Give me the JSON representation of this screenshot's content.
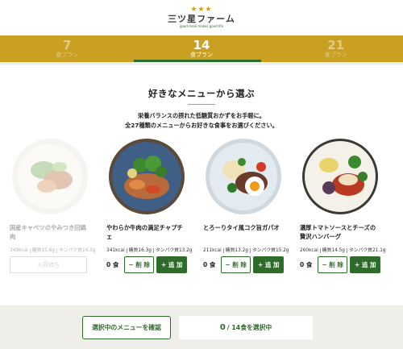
{
  "header": {
    "logo_stars": "★★★",
    "logo_name": "三ツ星ファーム",
    "logo_tagline": "good meal makes good life"
  },
  "plans": [
    {
      "number": "7",
      "label": "食プラン",
      "active": false
    },
    {
      "number": "14",
      "label": "食プラン",
      "active": true
    },
    {
      "number": "21",
      "label": "食プラン",
      "active": false
    }
  ],
  "section": {
    "title": "好きなメニューから選ぶ",
    "desc_line1": "栄養バランスの摂れた低糖質おかずをお手軽に。",
    "desc_line2": "全27種類のメニューからお好きな食事をお選びください。"
  },
  "menu": [
    {
      "name": "国産キャベツのやみつき回鍋肉",
      "kcal": "349kcal",
      "sugar": "糖質15.6g",
      "protein": "タンパク質14.3g",
      "status": "soldout",
      "wait_label": "入荷待ち",
      "plate_color": "#f3efe6"
    },
    {
      "name": "やわらか牛肉の満足チャプチェ",
      "kcal": "341kcal",
      "sugar": "糖質16.3g",
      "protein": "タンパク質13.2g",
      "status": "available",
      "count": "0 食",
      "remove_label": "− 削 除",
      "add_label": "+ 追 加",
      "plate_color": "#3f5f86"
    },
    {
      "name": "とろーりタイ風コク旨ガパオ",
      "kcal": "211kcal",
      "sugar": "糖質13.2g",
      "protein": "タンパク質15.2g",
      "status": "available",
      "count": "0 食",
      "remove_label": "− 削 除",
      "add_label": "+ 追 加",
      "plate_color": "#d8e2ea"
    },
    {
      "name": "濃厚トマトソースとチーズの贅沢ハンバーグ",
      "kcal": "260kcal",
      "sugar": "糖質14.5g",
      "protein": "タンパク質21.1g",
      "status": "available",
      "count": "0 食",
      "remove_label": "− 削 除",
      "add_label": "+ 追 加",
      "plate_color": "#f4f1e8"
    }
  ],
  "footer": {
    "confirm_label": "選択中のメニューを確認",
    "selected_count": "0",
    "selected_total": " / 14食を選択中"
  },
  "colors": {
    "gold": "#c9a021",
    "green": "#2f6b2a"
  }
}
